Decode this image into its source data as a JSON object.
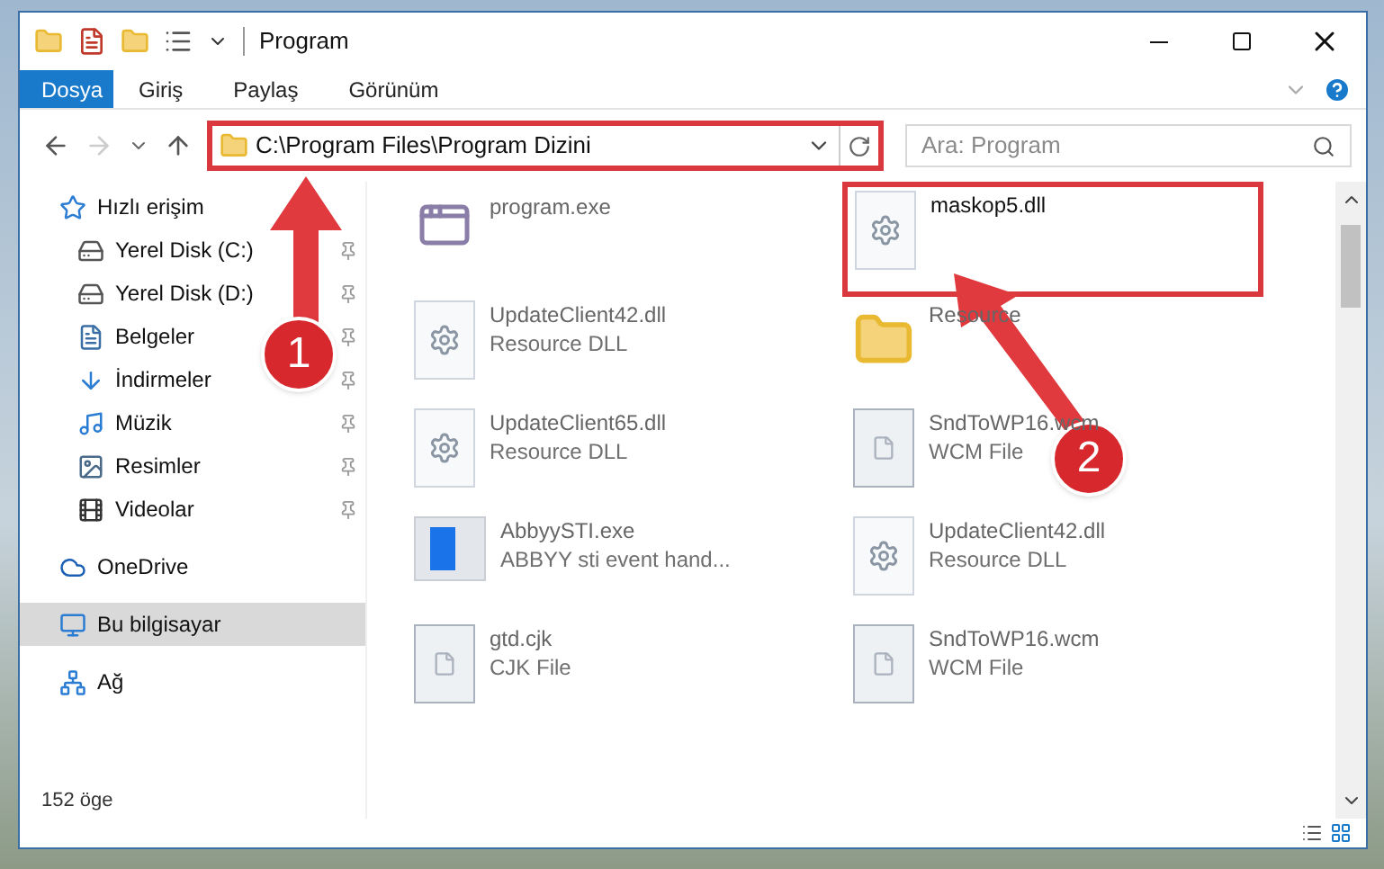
{
  "window": {
    "title": "Program"
  },
  "ribbon_tabs": [
    {
      "label": "Dosya",
      "selected": true
    },
    {
      "label": "Giriş",
      "selected": false
    },
    {
      "label": "Paylaş",
      "selected": false
    },
    {
      "label": "Görünüm",
      "selected": false
    }
  ],
  "address": {
    "path": "C:\\Program Files\\Program Dizini"
  },
  "search": {
    "placeholder": "Ara: Program"
  },
  "sidebar": {
    "items": [
      {
        "label": "Hızlı erişim",
        "kind": "star",
        "pinned": false,
        "selected": false
      },
      {
        "label": "Yerel Disk (C:)",
        "kind": "disk",
        "pinned": true,
        "selected": false
      },
      {
        "label": "Yerel Disk (D:)",
        "kind": "disk",
        "pinned": true,
        "selected": false
      },
      {
        "label": "Belgeler",
        "kind": "doc",
        "pinned": true,
        "selected": false
      },
      {
        "label": "İndirmeler",
        "kind": "download",
        "pinned": true,
        "selected": false
      },
      {
        "label": "Müzik",
        "kind": "music",
        "pinned": true,
        "selected": false
      },
      {
        "label": "Resimler",
        "kind": "image",
        "pinned": true,
        "selected": false
      },
      {
        "label": "Videolar",
        "kind": "video",
        "pinned": true,
        "selected": false
      },
      {
        "label": "OneDrive",
        "kind": "cloud",
        "pinned": false,
        "selected": false
      },
      {
        "label": "Bu bilgisayar",
        "kind": "pc",
        "pinned": false,
        "selected": true
      },
      {
        "label": "Ağ",
        "kind": "network",
        "pinned": false,
        "selected": false
      }
    ]
  },
  "files": [
    {
      "name": "program.exe",
      "kind": "app",
      "highlighted": false
    },
    {
      "name": "maskop5.dll",
      "kind": "dll",
      "highlighted": true
    },
    {
      "name": "UpdateClient42.dll",
      "type": "Resource DLL",
      "kind": "dll",
      "highlighted": false
    },
    {
      "name": "Resource",
      "kind": "folder",
      "highlighted": false
    },
    {
      "name": "UpdateClient65.dll",
      "type": "Resource DLL",
      "kind": "dll",
      "highlighted": false
    },
    {
      "name": "SndToWP16.wcm",
      "type": "WCM File",
      "kind": "file",
      "highlighted": false
    },
    {
      "name": "AbbyySTI.exe",
      "type": "ABBYY sti event hand...",
      "kind": "window",
      "highlighted": false
    },
    {
      "name": "UpdateClient42.dll",
      "type": "Resource DLL",
      "kind": "dll",
      "highlighted": false
    },
    {
      "name": "gtd.cjk",
      "type": "CJK File",
      "kind": "file",
      "highlighted": false
    },
    {
      "name": "SndToWP16.wcm",
      "type": "WCM File",
      "kind": "file",
      "highlighted": false
    }
  ],
  "status_bar": {
    "count": "152 öge"
  },
  "annotations": [
    {
      "number": "1"
    },
    {
      "number": "2"
    }
  ]
}
